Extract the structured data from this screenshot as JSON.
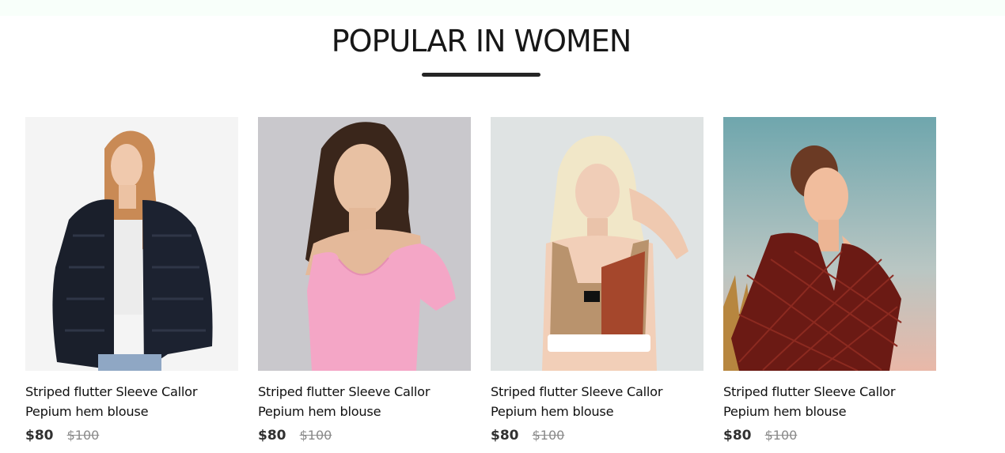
{
  "section": {
    "title": "POPULAR IN WOMEN"
  },
  "products": [
    {
      "name": "Striped flutter Sleeve Callor Pepium hem blouse",
      "new_price": "$80",
      "old_price": "$100",
      "image": "woman-black-fur-jacket"
    },
    {
      "name": "Striped flutter Sleeve Callor Pepium hem blouse",
      "new_price": "$80",
      "old_price": "$100",
      "image": "woman-pink-top"
    },
    {
      "name": "Striped flutter Sleeve Callor Pepium hem blouse",
      "new_price": "$80",
      "old_price": "$100",
      "image": "woman-sports-crop-top"
    },
    {
      "name": "Striped flutter Sleeve Callor Pepium hem blouse",
      "new_price": "$80",
      "old_price": "$100",
      "image": "woman-red-patterned-blouse"
    }
  ],
  "colors": {
    "title": "#171717",
    "price_new": "#313131",
    "price_old": "#8a8a8a"
  }
}
